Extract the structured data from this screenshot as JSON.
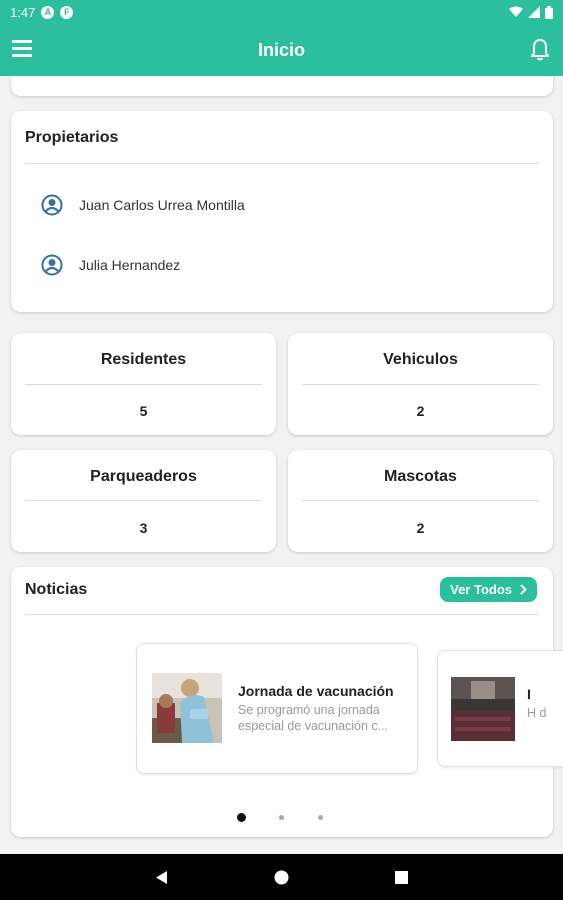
{
  "status_bar": {
    "time": "1:47",
    "icons": [
      "a-notification-icon",
      "f-notification-icon"
    ],
    "right_icons": [
      "wifi-icon",
      "signal-icon",
      "battery-icon"
    ]
  },
  "app_bar": {
    "title": "Inicio",
    "menu_icon": "hamburger-menu-icon",
    "bell_icon": "bell-icon"
  },
  "owners": {
    "title": "Propietarios",
    "items": [
      {
        "name": "Juan Carlos Urrea Montilla",
        "icon": "user-circle-icon"
      },
      {
        "name": "Julia Hernandez",
        "icon": "user-circle-icon"
      }
    ]
  },
  "stats": [
    {
      "label": "Residentes",
      "value": "5"
    },
    {
      "label": "Vehiculos",
      "value": "2"
    },
    {
      "label": "Parqueaderos",
      "value": "3"
    },
    {
      "label": "Mascotas",
      "value": "2"
    }
  ],
  "news": {
    "title": "Noticias",
    "see_all": "Ver Todos",
    "items": [
      {
        "title": "Jornada de vacunación",
        "description": "Se programó una jornada especial de vacunación c..."
      },
      {
        "title": "I",
        "description": "H d"
      }
    ],
    "pagination": {
      "count": 3,
      "active": 1
    }
  },
  "colors": {
    "accent": "#2bbf9d",
    "icon_blue": "#3a6ea5",
    "nav_bar": "#000000"
  },
  "nav_bar": {
    "buttons": [
      "back-icon",
      "home-icon",
      "recents-icon"
    ]
  }
}
